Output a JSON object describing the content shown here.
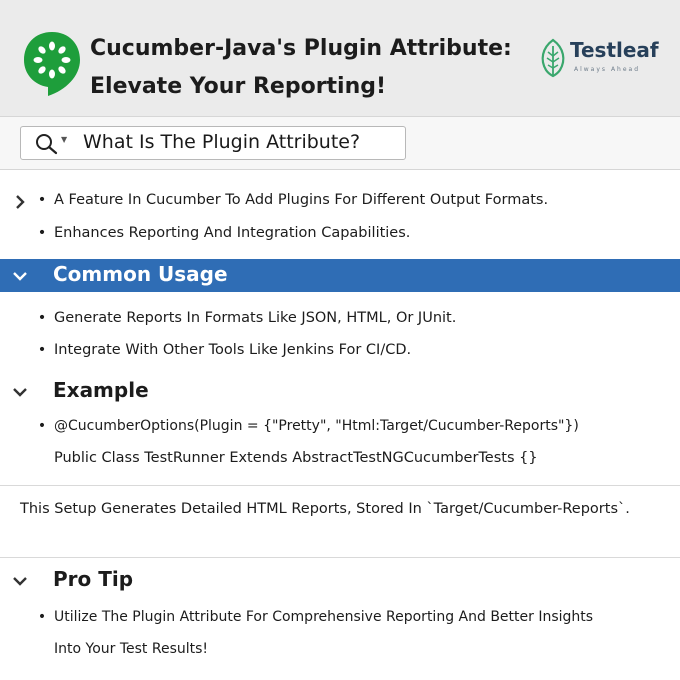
{
  "header": {
    "title_line1": "Cucumber-Java's Plugin Attribute:",
    "title_line2": "Elevate Your Reporting!",
    "brand_name": "Testleaf",
    "brand_tagline": "Always Ahead"
  },
  "search": {
    "query": "What Is The Plugin Attribute?"
  },
  "intro": {
    "items": [
      "A Feature In Cucumber To Add Plugins For Different Output Formats.",
      "Enhances Reporting And Integration Capabilities."
    ]
  },
  "common_usage": {
    "title": "Common Usage",
    "items": [
      "Generate Reports In Formats Like JSON, HTML, Or JUnit.",
      "Integrate With Other Tools Like Jenkins For CI/CD."
    ]
  },
  "example": {
    "title": "Example",
    "line1": "@CucumberOptions(Plugin = {\"Pretty\", \"Html:Target/Cucumber-Reports\"})",
    "line2": "Public Class TestRunner Extends AbstractTestNGCucumberTests {}"
  },
  "note": {
    "text": "This Setup Generates Detailed HTML Reports, Stored In `Target/Cucumber-Reports`."
  },
  "pro_tip": {
    "title": "Pro Tip",
    "line1": "Utilize The Plugin Attribute For Comprehensive Reporting And Better Insights",
    "line2": "Into Your Test Results!"
  },
  "colors": {
    "accent": "#2f6db5",
    "cucumber_green": "#1e9e3b",
    "brand_navy": "#27405a",
    "brand_leaf": "#3aa76d"
  },
  "icons": {
    "header_logo": "cucumber-logo-icon",
    "brand": "testleaf-leaf-icon",
    "search": "search-icon",
    "expand": "chevron-down-icon",
    "collapse": "chevron-right-icon"
  }
}
